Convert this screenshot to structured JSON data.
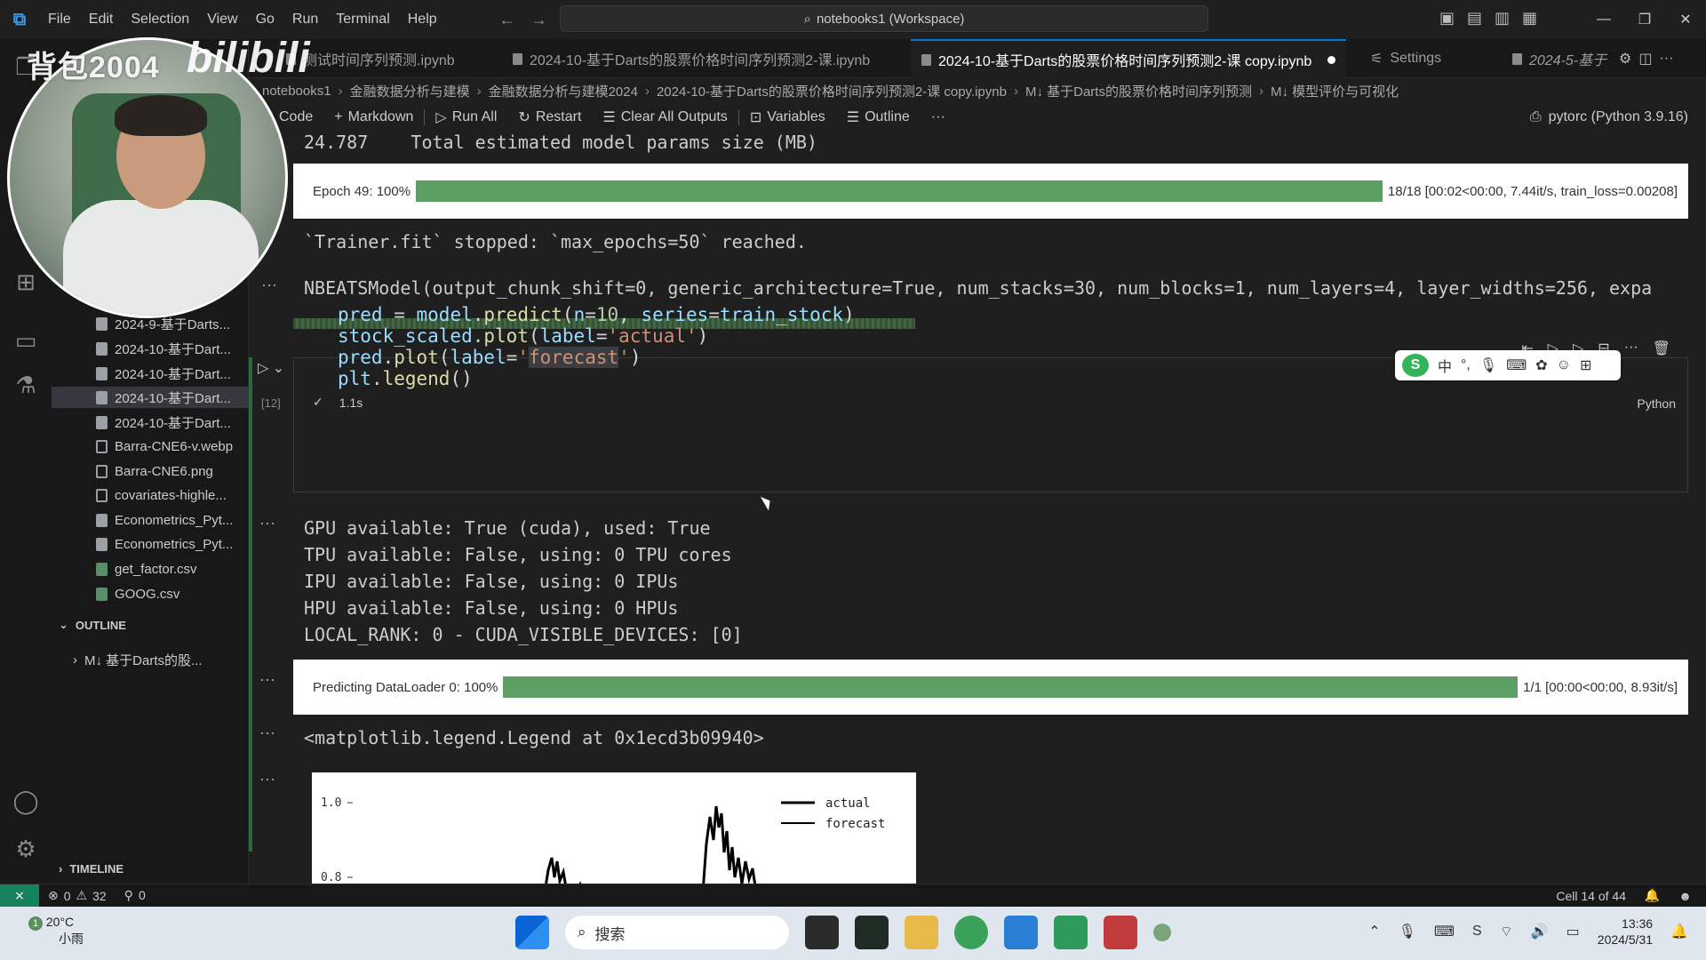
{
  "titlebar": {
    "menu": [
      "File",
      "Edit",
      "Selection",
      "View",
      "Go",
      "Run",
      "Terminal",
      "Help"
    ],
    "command_center": "notebooks1 (Workspace)"
  },
  "tabs": [
    {
      "label": "测试时间序列预测.ipynb",
      "active": false
    },
    {
      "label": "2024-10-基于Darts的股票价格时间序列预测2-课.ipynb",
      "active": false
    },
    {
      "label": "2024-10-基于Darts的股票价格时间序列预测2-课 copy.ipynb",
      "active": true
    },
    {
      "label": "Settings",
      "active": false
    },
    {
      "label": "2024-5-基于",
      "active": false
    }
  ],
  "breadcrumb": [
    "notebooks1",
    "金融数据分析与建模",
    "金融数据分析与建模2024",
    "2024-10-基于Darts的股票价格时间序列预测2-课 copy.ipynb",
    "M↓ 基于Darts的股票价格时间序列预测",
    "M↓ 模型评价与可视化"
  ],
  "toolbar": {
    "code": "Code",
    "markdown": "Markdown",
    "run_all": "Run All",
    "restart": "Restart",
    "clear_outputs": "Clear All Outputs",
    "variables": "Variables",
    "outline": "Outline",
    "more": "···",
    "kernel": "pytorc (Python 3.9.16)"
  },
  "sidebar": {
    "files": [
      {
        "label": "2024-9-基于Darts...",
        "type": "nb"
      },
      {
        "label": "2024-10-基于Dart...",
        "type": "nb"
      },
      {
        "label": "2024-10-基于Dart...",
        "type": "nb"
      },
      {
        "label": "2024-10-基于Dart...",
        "type": "nb",
        "active": true
      },
      {
        "label": "2024-10-基于Dart...",
        "type": "nb"
      },
      {
        "label": "Barra-CNE6-v.webp",
        "type": "img"
      },
      {
        "label": "Barra-CNE6.png",
        "type": "img"
      },
      {
        "label": "covariates-highle...",
        "type": "img"
      },
      {
        "label": "Econometrics_Pyt...",
        "type": "nb"
      },
      {
        "label": "Econometrics_Pyt...",
        "type": "nb"
      },
      {
        "label": "get_factor.csv",
        "type": "csv"
      },
      {
        "label": "GOOG.csv",
        "type": "csv"
      }
    ],
    "outline_title": "OUTLINE",
    "outline_item": "M↓ 基于Darts的股...",
    "timeline_title": "TIMELINE"
  },
  "outputs": {
    "params_line": "24.787    Total estimated model params size (MB)",
    "epoch_label": "Epoch 49: 100%",
    "epoch_stats": "18/18 [00:02<00:00, 7.44it/s, train_loss=0.00208]",
    "epoch_progress": 1.0,
    "trainer_stopped": "`Trainer.fit` stopped: `max_epochs=50` reached.",
    "model_repr": "NBEATSModel(output_chunk_shift=0, generic_architecture=True, num_stacks=30, num_blocks=1, num_layers=4, layer_widths=256, expa",
    "gpu_lines": [
      "GPU available: True (cuda), used: True",
      "TPU available: False, using: 0 TPU cores",
      "IPU available: False, using: 0 IPUs",
      "HPU available: False, using: 0 HPUs",
      "LOCAL_RANK: 0 - CUDA_VISIBLE_DEVICES: [0]"
    ],
    "predict_label": "Predicting DataLoader 0: 100%",
    "predict_stats": "1/1 [00:00<00:00, 8.93it/s]",
    "predict_progress": 1.0,
    "legend_repr": "<matplotlib.legend.Legend at 0x1ecd3b09940>"
  },
  "cell": {
    "exec_count": "[12]",
    "duration": "1.1s",
    "language": "Python"
  },
  "plot": {
    "yticks": [
      "1.0",
      "0.8"
    ],
    "legend": [
      "actual",
      "forecast"
    ]
  },
  "statusbar": {
    "errors": "0",
    "warnings": "32",
    "ports": "0",
    "cell_position": "Cell 14 of 44"
  },
  "taskbar": {
    "temperature": "20°C",
    "weather": "小雨",
    "weather_badge": "1",
    "search_placeholder": "搜索",
    "time": "13:36",
    "date": "2024/5/31"
  },
  "overlay": {
    "watermark": "背包2004",
    "platform": "bilibili"
  }
}
